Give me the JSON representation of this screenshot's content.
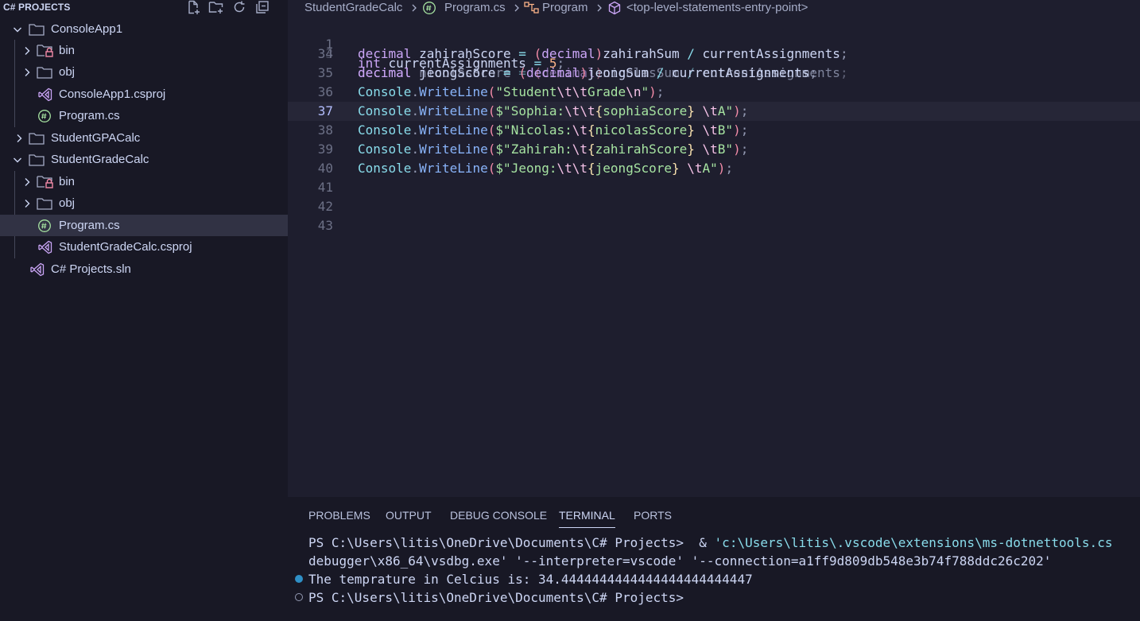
{
  "explorer": {
    "title": "C# PROJECTS",
    "items": [
      {
        "label": "ConsoleApp1",
        "type": "folder",
        "expanded": true
      },
      {
        "label": "bin",
        "type": "folder-locked"
      },
      {
        "label": "obj",
        "type": "folder"
      },
      {
        "label": "ConsoleApp1.csproj",
        "type": "csproj"
      },
      {
        "label": "Program.cs",
        "type": "csharp"
      },
      {
        "label": "StudentGPACalc",
        "type": "folder",
        "expanded": false
      },
      {
        "label": "StudentGradeCalc",
        "type": "folder",
        "expanded": true
      },
      {
        "label": "bin",
        "type": "folder-locked"
      },
      {
        "label": "obj",
        "type": "folder"
      },
      {
        "label": "Program.cs",
        "type": "csharp",
        "selected": true
      },
      {
        "label": "StudentGradeCalc.csproj",
        "type": "csproj"
      },
      {
        "label": "C# Projects.sln",
        "type": "sln"
      }
    ]
  },
  "breadcrumb": {
    "folder": "StudentGradeCalc",
    "file": "Program.cs",
    "symbol": "Program",
    "member": "<top-level-statements-entry-point>"
  },
  "editor": {
    "sticky": {
      "num": "1",
      "tokens": [
        {
          "t": "int",
          "c": "ty"
        },
        {
          "t": " currentAssignments ",
          "c": "id"
        },
        {
          "t": "=",
          "c": "op"
        },
        {
          "t": " ",
          "c": "id"
        },
        {
          "t": "5",
          "c": "num"
        },
        {
          "t": ";",
          "c": "pun"
        }
      ]
    },
    "partial_line": {
      "num": "33",
      "tokens": [
        {
          "t": "decimal",
          "c": "ty"
        },
        {
          "t": " nicolasScore ",
          "c": "id"
        },
        {
          "t": "=",
          "c": "op"
        },
        {
          "t": " ",
          "c": "id"
        },
        {
          "t": "(",
          "c": "par"
        },
        {
          "t": "decimal",
          "c": "ty"
        },
        {
          "t": ")",
          "c": "par"
        },
        {
          "t": "nicolasSum ",
          "c": "id"
        },
        {
          "t": "/",
          "c": "op"
        },
        {
          "t": " currentAssignments",
          "c": "id"
        },
        {
          "t": ";",
          "c": "pun"
        }
      ]
    },
    "lines": [
      {
        "num": "34",
        "tokens": [
          {
            "t": "decimal",
            "c": "ty"
          },
          {
            "t": " zahirahScore ",
            "c": "id"
          },
          {
            "t": "=",
            "c": "op"
          },
          {
            "t": " ",
            "c": "id"
          },
          {
            "t": "(",
            "c": "par"
          },
          {
            "t": "decimal",
            "c": "ty"
          },
          {
            "t": ")",
            "c": "par"
          },
          {
            "t": "zahirahSum ",
            "c": "id"
          },
          {
            "t": "/",
            "c": "op"
          },
          {
            "t": " currentAssignments",
            "c": "id"
          },
          {
            "t": ";",
            "c": "pun"
          }
        ]
      },
      {
        "num": "35",
        "tokens": [
          {
            "t": "decimal",
            "c": "ty"
          },
          {
            "t": " jeongScore ",
            "c": "id"
          },
          {
            "t": "=",
            "c": "op"
          },
          {
            "t": " ",
            "c": "id"
          },
          {
            "t": "(",
            "c": "par"
          },
          {
            "t": "decimal",
            "c": "ty"
          },
          {
            "t": ")",
            "c": "par"
          },
          {
            "t": "jeongSum ",
            "c": "id"
          },
          {
            "t": "/",
            "c": "op"
          },
          {
            "t": " currentAssignments",
            "c": "id"
          },
          {
            "t": ";",
            "c": "pun"
          }
        ]
      },
      {
        "num": "36",
        "tokens": [
          {
            "t": "Console",
            "c": "cls"
          },
          {
            "t": ".",
            "c": "pun"
          },
          {
            "t": "WriteLine",
            "c": "fn"
          },
          {
            "t": "(",
            "c": "par"
          },
          {
            "t": "\"Student",
            "c": "str"
          },
          {
            "t": "\\t\\t",
            "c": "esc"
          },
          {
            "t": "Grade",
            "c": "str"
          },
          {
            "t": "\\n",
            "c": "esc"
          },
          {
            "t": "\"",
            "c": "str"
          },
          {
            "t": ")",
            "c": "par"
          },
          {
            "t": ";",
            "c": "pun"
          }
        ]
      },
      {
        "num": "37",
        "current": true,
        "tokens": [
          {
            "t": "Console",
            "c": "cls"
          },
          {
            "t": ".",
            "c": "pun"
          },
          {
            "t": "WriteLine",
            "c": "fn"
          },
          {
            "t": "(",
            "c": "par"
          },
          {
            "t": "$\"Sophia:",
            "c": "str"
          },
          {
            "t": "\\t\\t",
            "c": "esc"
          },
          {
            "t": "{",
            "c": "brc"
          },
          {
            "t": "sophiaScore",
            "c": "str"
          },
          {
            "t": "}",
            "c": "brc"
          },
          {
            "t": " ",
            "c": "str"
          },
          {
            "t": "\\t",
            "c": "esc"
          },
          {
            "t": "A\"",
            "c": "str"
          },
          {
            "t": ")",
            "c": "par"
          },
          {
            "t": ";",
            "c": "pun"
          }
        ]
      },
      {
        "num": "38",
        "tokens": [
          {
            "t": "Console",
            "c": "cls"
          },
          {
            "t": ".",
            "c": "pun"
          },
          {
            "t": "WriteLine",
            "c": "fn"
          },
          {
            "t": "(",
            "c": "par"
          },
          {
            "t": "$\"Nicolas:",
            "c": "str"
          },
          {
            "t": "\\t",
            "c": "esc"
          },
          {
            "t": "{",
            "c": "brc"
          },
          {
            "t": "nicolasScore",
            "c": "str"
          },
          {
            "t": "}",
            "c": "brc"
          },
          {
            "t": " ",
            "c": "str"
          },
          {
            "t": "\\t",
            "c": "esc"
          },
          {
            "t": "B\"",
            "c": "str"
          },
          {
            "t": ")",
            "c": "par"
          },
          {
            "t": ";",
            "c": "pun"
          }
        ]
      },
      {
        "num": "39",
        "tokens": [
          {
            "t": "Console",
            "c": "cls"
          },
          {
            "t": ".",
            "c": "pun"
          },
          {
            "t": "WriteLine",
            "c": "fn"
          },
          {
            "t": "(",
            "c": "par"
          },
          {
            "t": "$\"Zahirah:",
            "c": "str"
          },
          {
            "t": "\\t",
            "c": "esc"
          },
          {
            "t": "{",
            "c": "brc"
          },
          {
            "t": "zahirahScore",
            "c": "str"
          },
          {
            "t": "}",
            "c": "brc"
          },
          {
            "t": " ",
            "c": "str"
          },
          {
            "t": "\\t",
            "c": "esc"
          },
          {
            "t": "B\"",
            "c": "str"
          },
          {
            "t": ")",
            "c": "par"
          },
          {
            "t": ";",
            "c": "pun"
          }
        ]
      },
      {
        "num": "40",
        "tokens": [
          {
            "t": "Console",
            "c": "cls"
          },
          {
            "t": ".",
            "c": "pun"
          },
          {
            "t": "WriteLine",
            "c": "fn"
          },
          {
            "t": "(",
            "c": "par"
          },
          {
            "t": "$\"Jeong:",
            "c": "str"
          },
          {
            "t": "\\t\\t",
            "c": "esc"
          },
          {
            "t": "{",
            "c": "brc"
          },
          {
            "t": "jeongScore",
            "c": "str"
          },
          {
            "t": "}",
            "c": "brc"
          },
          {
            "t": " ",
            "c": "str"
          },
          {
            "t": "\\t",
            "c": "esc"
          },
          {
            "t": "A\"",
            "c": "str"
          },
          {
            "t": ")",
            "c": "par"
          },
          {
            "t": ";",
            "c": "pun"
          }
        ]
      },
      {
        "num": "41",
        "tokens": []
      },
      {
        "num": "42",
        "tokens": []
      },
      {
        "num": "43",
        "tokens": []
      }
    ]
  },
  "panel": {
    "tabs": [
      "PROBLEMS",
      "OUTPUT",
      "DEBUG CONSOLE",
      "TERMINAL",
      "PORTS"
    ],
    "active_tab": "TERMINAL"
  },
  "terminal": {
    "line1_prompt": "PS C:\\Users\\litis\\OneDrive\\Documents\\C# Projects>  & ",
    "line1_path": "'c:\\Users\\litis\\.vscode\\extensions\\ms-dotnettools.cs",
    "line2_path": "debugger\\x86_64\\vsdbg.exe' '--interpreter=vscode' '--connection=a1ff9d809db548e3b74f788ddc26c202'",
    "line3": "The temprature in Celcius is: 34.4444444444444444444444447",
    "line4": "PS C:\\Users\\litis\\OneDrive\\Documents\\C# Projects>"
  },
  "colors": {
    "editor_bg": "#1e1e2e",
    "sidebar_bg": "#181825",
    "selection_bg": "#313244",
    "keyword": "#cba6f7",
    "string": "#a6e3a1",
    "class": "#89dceb",
    "function": "#89b4fa",
    "number": "#fab387"
  }
}
